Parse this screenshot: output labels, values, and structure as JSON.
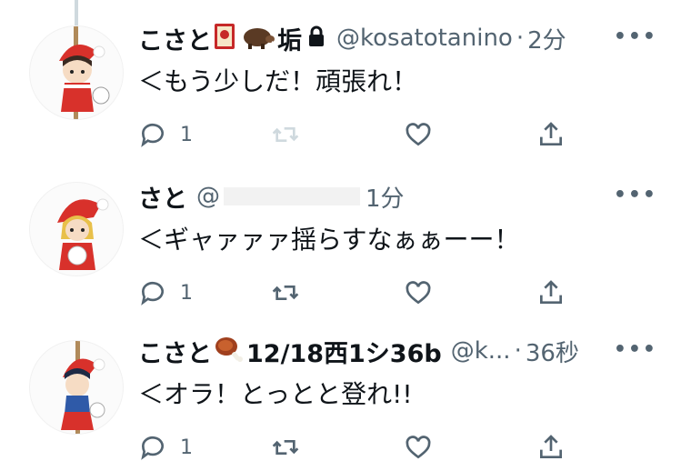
{
  "tweets": [
    {
      "name": "こさと",
      "name_suffix": "垢",
      "badge_icons": [
        "hanafuda-card-icon",
        "boar-icon",
        "lock-icon"
      ],
      "handle": "@kosatotanino",
      "separator": "·",
      "time": "2分",
      "text": "＜もう少しだ！頑張れ！",
      "reply_count": "1",
      "retweet_active": false
    },
    {
      "name": "さと",
      "handle": "@",
      "handle_hidden": true,
      "time": "1分",
      "text": "＜ギャァァァ揺らすなぁぁーー！",
      "reply_count": "1",
      "retweet_active": true
    },
    {
      "name": "こさと",
      "name_suffix": "12/18西1シ36b",
      "badge_icons": [
        "meat-icon"
      ],
      "handle": "@k...",
      "separator": "·",
      "time": "36秒",
      "text": "＜オラ！とっとと登れ!!",
      "reply_count": "1",
      "retweet_active": true
    }
  ],
  "colors": {
    "text": "#0f1419",
    "secondary": "#536471",
    "icon": "#536471",
    "icon_disabled": "#cfd9de",
    "santa_red": "#d8312b"
  }
}
